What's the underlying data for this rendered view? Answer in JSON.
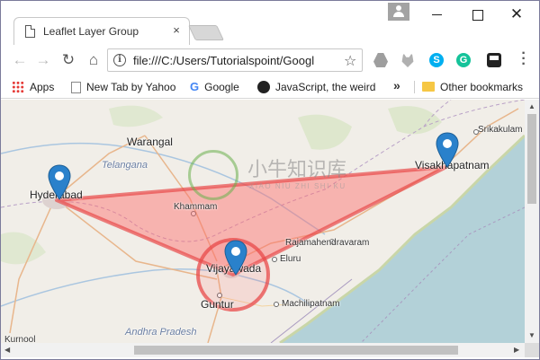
{
  "window": {
    "tab_title": "Leaflet Layer Group",
    "tab_close": "×",
    "min_label": "",
    "max_label": "",
    "close_label": "✕"
  },
  "toolbar": {
    "back": "←",
    "forward": "→",
    "reload": "↻",
    "home": "⌂",
    "info": "i",
    "url": "file:///C:/Users/Tutorialspoint/Googl",
    "star": "☆",
    "skype": "S",
    "grammarly": "G",
    "menu": "⋮"
  },
  "bookmarks": {
    "items": [
      {
        "label": "Apps",
        "icon": "apps-grid-icon"
      },
      {
        "label": "New Tab by Yahoo",
        "icon": "page-icon"
      },
      {
        "label": "Google",
        "icon": "google-icon"
      },
      {
        "label": "JavaScript, the weird",
        "icon": "js-icon"
      }
    ],
    "google_glyph": "G",
    "more": "»",
    "other": "Other bookmarks"
  },
  "map": {
    "cities": {
      "warangal": "Warangal",
      "telangana": "Telangana",
      "hyderabad": "Hyderabad",
      "khammam": "Khammam",
      "visakhapatnam": "Visakhapatnam",
      "srikakulam": "Srikakulam",
      "rajamahendravaram": "Rajamahendravaram",
      "vijayawada": "Vijayawada",
      "eluru": "Eluru",
      "guntur": "Guntur",
      "machilipatnam": "Machilipatnam",
      "andhra_pradesh": "Andhra Pradesh",
      "kurnool": "Kurnool"
    },
    "watermark": {
      "title": "小牛知识库",
      "subtitle": "XIAO NIU ZHI SHI KU"
    },
    "overlay_color": "#e84a4a",
    "marker_color": "#2a81cb"
  },
  "scrollbars": {
    "up": "▲",
    "down": "▼",
    "left": "◀",
    "right": "▶"
  }
}
